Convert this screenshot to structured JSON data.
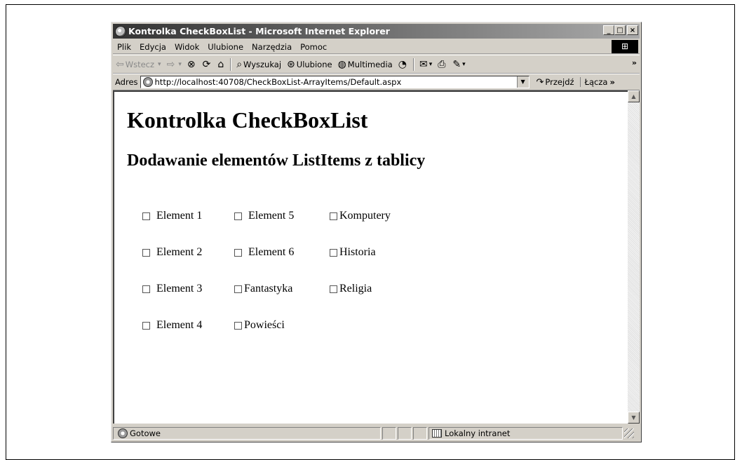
{
  "window": {
    "title": "Kontrolka CheckBoxList - Microsoft Internet Explorer",
    "minimize": "_",
    "maximize": "□",
    "close": "×"
  },
  "menu": [
    "Plik",
    "Edycja",
    "Widok",
    "Ulubione",
    "Narzędzia",
    "Pomoc"
  ],
  "toolbar": {
    "back": "Wstecz",
    "search": "Wyszukaj",
    "favorites": "Ulubione",
    "multimedia": "Multimedia"
  },
  "address": {
    "label": "Adres",
    "url": "http://localhost:40708/CheckBoxList-ArrayItems/Default.aspx",
    "go": "Przejdź",
    "links": "Łącza"
  },
  "page": {
    "heading": "Kontrolka CheckBoxList",
    "subheading": "Dodawanie elementów ListItems z tablicy",
    "checkbox_columns": [
      [
        "Element 1",
        "Element 2",
        "Element 3",
        "Element 4"
      ],
      [
        "Element 5",
        "Element 6",
        "Fantastyka",
        "Powieści"
      ],
      [
        "Komputery",
        "Historia",
        "Religia"
      ]
    ]
  },
  "status": {
    "text": "Gotowe",
    "zone": "Lokalny intranet"
  }
}
